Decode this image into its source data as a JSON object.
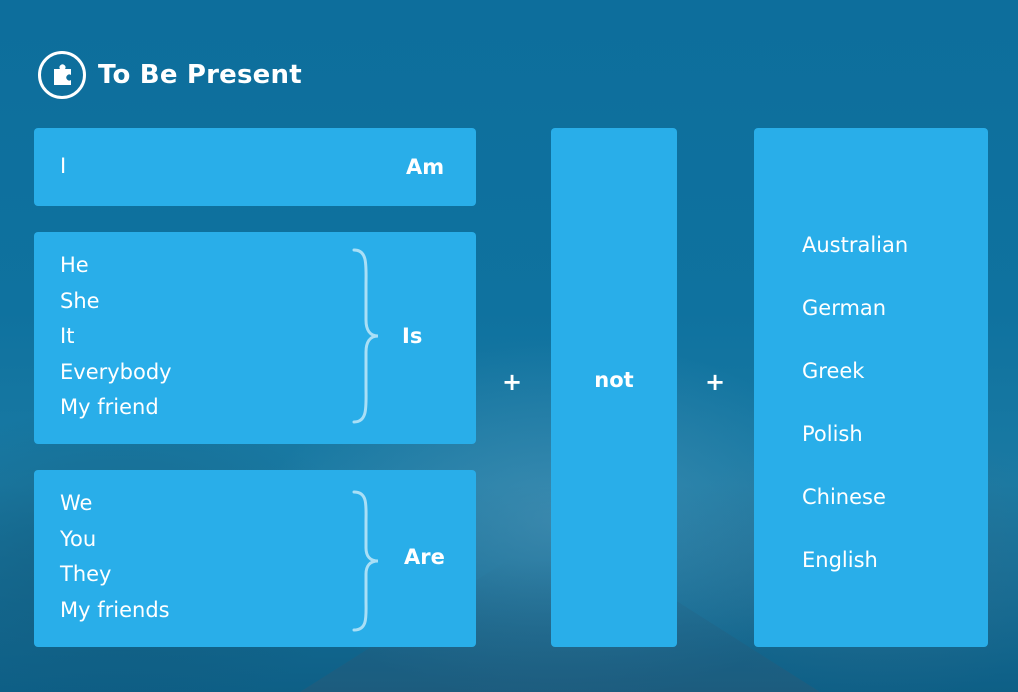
{
  "header": {
    "title": "To Be Present",
    "icon": "puzzle-icon"
  },
  "rows": {
    "am": {
      "subjects": [
        "I"
      ],
      "verb": "Am"
    },
    "is": {
      "subjects": [
        "He",
        "She",
        "It",
        "Everybody",
        "My friend"
      ],
      "verb": "Is"
    },
    "are": {
      "subjects": [
        "We",
        "You",
        "They",
        "My friends"
      ],
      "verb": "Are"
    }
  },
  "operators": {
    "plus_left": "+",
    "negation": "not",
    "plus_right": "+"
  },
  "nationalities": [
    "Australian",
    "German",
    "Greek",
    "Polish",
    "Chinese",
    "English"
  ],
  "colors": {
    "background": "#0f6f9b",
    "box": "#29aee9",
    "brace": "#a9dff6",
    "text": "#ffffff"
  }
}
